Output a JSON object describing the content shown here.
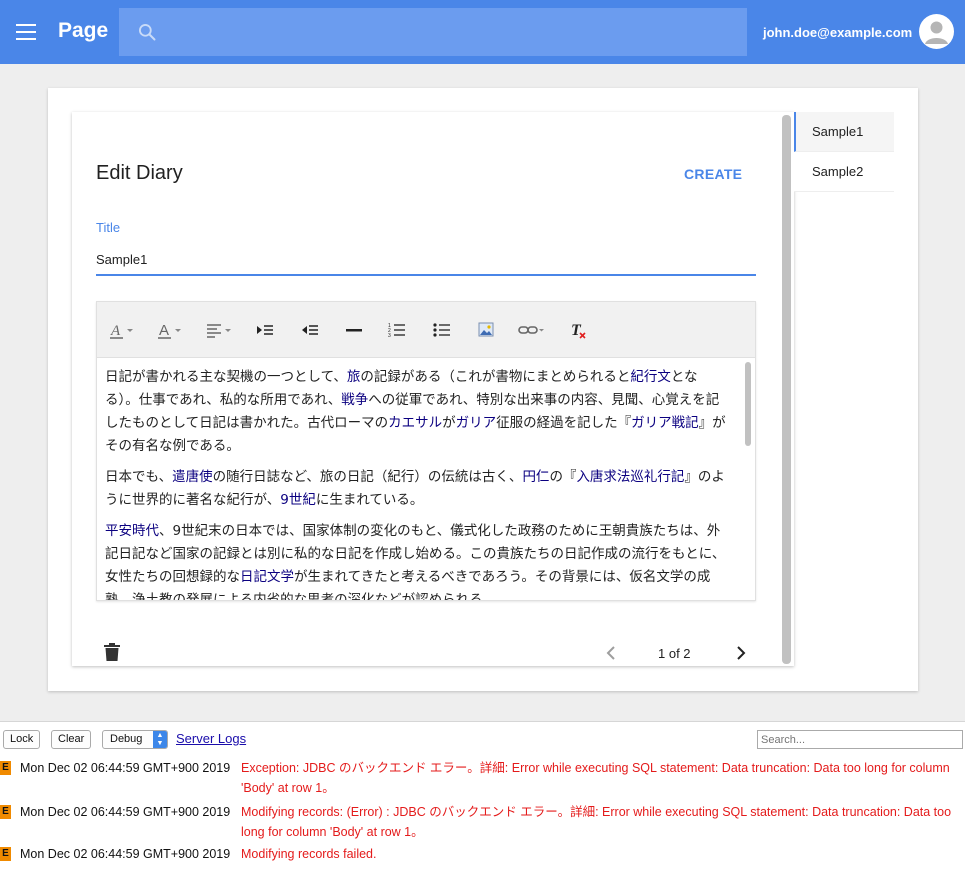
{
  "appbar": {
    "title": "Page",
    "search_placeholder": "",
    "user_email": "john.doe@example.com",
    "color": "#4a86e8"
  },
  "form": {
    "heading": "Edit Diary",
    "create_label": "CREATE",
    "title_label": "Title",
    "title_value": "Sample1",
    "toolbar": [
      "text-color-icon",
      "background-color-icon",
      "align-icon",
      "indent-icon",
      "outdent-icon",
      "horizontal-rule-icon",
      "numbered-list-icon",
      "bulleted-list-icon",
      "image-icon",
      "link-icon",
      "clear-format-icon"
    ],
    "body": {
      "p1": [
        {
          "t": "日記が書かれる主な契機の一つとして、"
        },
        {
          "t": "旅",
          "link": true
        },
        {
          "t": "の記録がある（これが書物にまとめられると"
        },
        {
          "t": "紀行文",
          "link": true
        },
        {
          "t": "となる）。仕事であれ、私的な所用であれ、"
        },
        {
          "t": "戦争",
          "link": true
        },
        {
          "t": "への従軍であれ、特別な出来事の内容、見聞、心覚えを記したものとして日記は書かれた。古代ローマの"
        },
        {
          "t": "カエサル",
          "link": true
        },
        {
          "t": "が"
        },
        {
          "t": "ガリア",
          "link": true
        },
        {
          "t": "征服の経過を記した『"
        },
        {
          "t": "ガリア戦記",
          "link": true
        },
        {
          "t": "』がその有名な例である。"
        }
      ],
      "p2": [
        {
          "t": "日本でも、"
        },
        {
          "t": "遣唐使",
          "link": true
        },
        {
          "t": "の随行日誌など、旅の日記（紀行）の伝統は古く、"
        },
        {
          "t": "円仁",
          "link": true
        },
        {
          "t": "の『"
        },
        {
          "t": "入唐求法巡礼行記",
          "link": true
        },
        {
          "t": "』のように世界的に著名な紀行が、"
        },
        {
          "t": "9世紀",
          "link": true
        },
        {
          "t": "に生まれている。"
        }
      ],
      "p3": [
        {
          "t": "平安時代",
          "link": true
        },
        {
          "t": "、9世紀末の日本では、国家体制の変化のもと、儀式化した政務のために王朝貴族たちは、外記日記など国家の記録とは別に私的な日記を作成し始める。この貴族たちの日記作成の流行をもとに、女性たちの回想録的な"
        },
        {
          "t": "日記文学",
          "link": true
        },
        {
          "t": "が生まれてきたと考えるべきであろう。その背景には、仮名文学の成熟、浄土教の発展による内省的な思考の深化などが認められる。"
        }
      ]
    },
    "pagination": "1 of 2"
  },
  "side_list": {
    "items": [
      "Sample1",
      "Sample2"
    ],
    "selected": "Sample1"
  },
  "console": {
    "lock_label": "Lock",
    "clear_label": "Clear",
    "level_value": "Debug",
    "server_logs_label": "Server Logs",
    "search_placeholder": "Search...",
    "logs": [
      {
        "level": "E",
        "time": "Mon Dec 02 06:44:59 GMT+900 2019",
        "message": "Exception: JDBC のバックエンド エラー。詳細: Error while executing SQL statement: Data truncation: Data too long for column 'Body' at row 1。"
      },
      {
        "level": "E",
        "time": "Mon Dec 02 06:44:59 GMT+900 2019",
        "message": "Modifying records: (Error) : JDBC のバックエンド エラー。詳細: Error while executing SQL statement: Data truncation: Data too long for column 'Body' at row 1。"
      },
      {
        "level": "E",
        "time": "Mon Dec 02 06:44:59 GMT+900 2019",
        "message": "Modifying records failed."
      }
    ],
    "error_color": "#e41b1b",
    "badge_color": "#f08a00"
  }
}
